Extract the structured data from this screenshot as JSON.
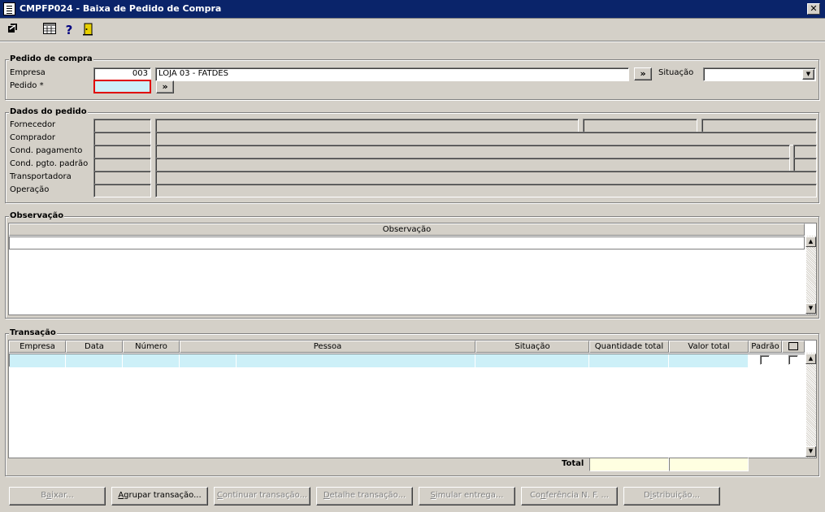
{
  "window": {
    "title": "CMPFP024 - Baixa de Pedido de Compra",
    "close_glyph": "✕"
  },
  "toolbar": {
    "icons": [
      "arrow-icon",
      "grid-icon",
      "help-icon",
      "exit-door-icon"
    ],
    "help_glyph": "?"
  },
  "pedido": {
    "legend": "Pedido de compra",
    "empresa_label": "Empresa",
    "empresa_code": "003",
    "empresa_name": "LOJA 03 - FATDES",
    "lookup_glyph": "»",
    "situacao_label": "Situação",
    "situacao_value": "",
    "pedido_label": "Pedido *",
    "pedido_value": ""
  },
  "dados": {
    "legend": "Dados do pedido",
    "labels": [
      "Fornecedor",
      "Comprador",
      "Cond. pagamento",
      "Cond. pgto. padrão",
      "Transportadora",
      "Operação"
    ]
  },
  "observacao": {
    "legend": "Observação",
    "column_header": "Observação"
  },
  "transacao": {
    "legend": "Transação",
    "columns": [
      "Empresa",
      "Data",
      "Número",
      "Pessoa",
      "Situação",
      "Quantidade total",
      "Valor total",
      "Padrão"
    ],
    "total_label": "Total"
  },
  "buttons": {
    "baixar": {
      "pre": "B",
      "u": "a",
      "post": "ixar..."
    },
    "agrupar": {
      "pre": "",
      "u": "A",
      "post": "grupar transação..."
    },
    "continuar": {
      "pre": "",
      "u": "C",
      "post": "ontinuar transação..."
    },
    "detalhe": {
      "pre": "",
      "u": "D",
      "post": "etalhe transação..."
    },
    "simular": {
      "pre": "",
      "u": "S",
      "post": "imular entrega..."
    },
    "conferencia": {
      "pre": "Co",
      "u": "n",
      "post": "ferência N. F. ..."
    },
    "distribuicao": {
      "pre": "D",
      "u": "i",
      "post": "stribuição..."
    }
  },
  "colors": {
    "title_bg": "#0a246a",
    "required_border": "#e00000",
    "row_fill": "#cdf0f8",
    "total_fill": "#ffffe1"
  }
}
